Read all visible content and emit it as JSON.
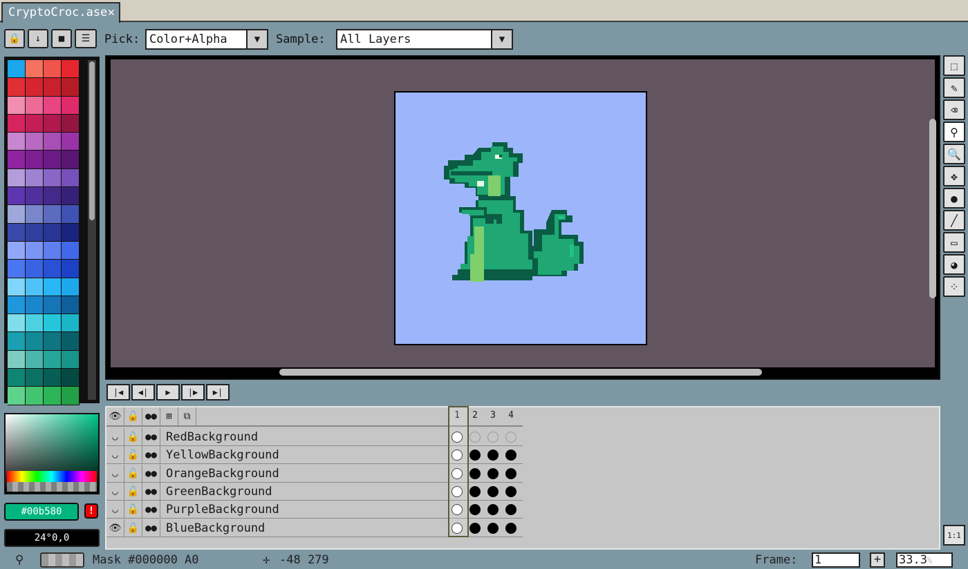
{
  "tab": {
    "title": "CryptoCroc.ase",
    "close": "✕"
  },
  "toolbar": {
    "pick_label": "Pick:",
    "pick_value": "Color+Alpha",
    "sample_label": "Sample:",
    "sample_value": "All Layers"
  },
  "palette_colors": [
    "#1aa7ec",
    "#f4725f",
    "#f0544a",
    "#e6262e",
    "#e02f35",
    "#d42530",
    "#c8202c",
    "#b61c26",
    "#f08fb0",
    "#ec6b97",
    "#e84582",
    "#e02b6a",
    "#d6245f",
    "#c41e56",
    "#b0194d",
    "#941640",
    "#c786cf",
    "#b86ac2",
    "#a84fb5",
    "#9a33a8",
    "#9023a0",
    "#7e1e93",
    "#6c1a85",
    "#591673",
    "#b39ddb",
    "#9e82d1",
    "#8a66c7",
    "#7651bd",
    "#5e35b1",
    "#51309e",
    "#44298b",
    "#372178",
    "#9fa8da",
    "#7986cb",
    "#5c6bc0",
    "#3f51b5",
    "#3949ab",
    "#303f9f",
    "#283593",
    "#1a237e",
    "#90a8f7",
    "#7b95f4",
    "#5f7ef0",
    "#4268ea",
    "#4a76f0",
    "#3a63e3",
    "#2a50d6",
    "#1c41c4",
    "#81d4fa",
    "#4fc3f7",
    "#29b6f6",
    "#1ea8ec",
    "#1f97dc",
    "#1a86cc",
    "#1575b7",
    "#0f5f9c",
    "#80deea",
    "#4dd0e1",
    "#26c6da",
    "#1bb5c8",
    "#1aa0b0",
    "#138a98",
    "#0e7581",
    "#095f68",
    "#7fcdc2",
    "#4db6ac",
    "#26a69a",
    "#1a958a",
    "#0f8576",
    "#0b7165",
    "#075e54",
    "#054a42",
    "#5fd38c",
    "#43c470",
    "#2cb556",
    "#22a047"
  ],
  "color": {
    "hex": "#00b580",
    "hsv": "24°0,0",
    "warning": "!",
    "base": "#00b580"
  },
  "timeline": {
    "header_icons": [
      "eye-icon",
      "lock-icon",
      "onion-skin-icon",
      "link-icon",
      "layer-icon"
    ],
    "frames": [
      "1",
      "2",
      "3",
      "4"
    ],
    "layers": [
      {
        "name": "RedBackground",
        "cels": [
          "white",
          "hollow",
          "hollow",
          "hollow"
        ],
        "visible": "◡"
      },
      {
        "name": "YellowBackground",
        "cels": [
          "white",
          "dot",
          "dot",
          "dot"
        ],
        "visible": "◡"
      },
      {
        "name": "OrangeBackground",
        "cels": [
          "white",
          "dot",
          "dot",
          "dot"
        ],
        "visible": "◡"
      },
      {
        "name": "GreenBackground",
        "cels": [
          "white",
          "dot",
          "dot",
          "dot"
        ],
        "visible": "◡"
      },
      {
        "name": "PurpleBackground",
        "cels": [
          "white",
          "dot",
          "dot",
          "dot"
        ],
        "visible": "◡"
      },
      {
        "name": "BlueBackground",
        "cels": [
          "white",
          "dot",
          "dot",
          "dot"
        ],
        "visible": "👁"
      }
    ]
  },
  "status": {
    "mask": "Mask #000000 A0",
    "coords": "-48 279",
    "frame_label": "Frame:",
    "frame_value": "1",
    "zoom": "33.3",
    "zoom_unit": "%",
    "plus": "+",
    "ratio": "1:1"
  }
}
